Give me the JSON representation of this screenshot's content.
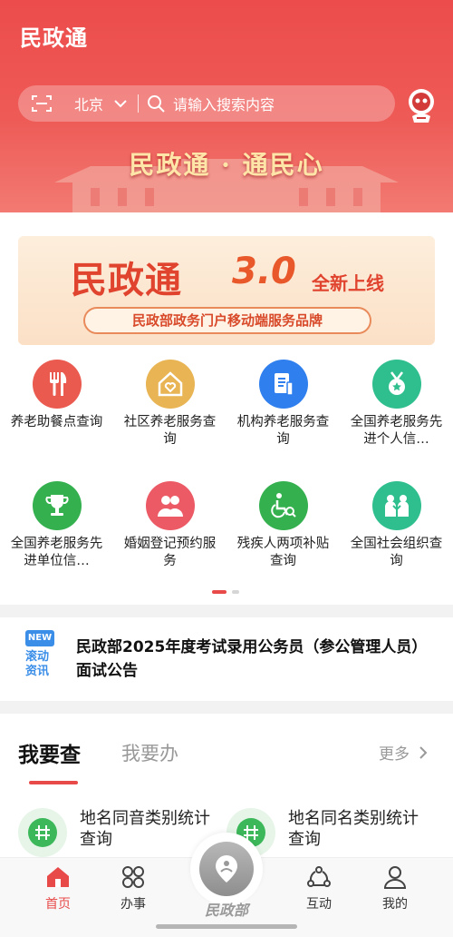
{
  "header": {
    "title": "民政通",
    "city": "北京",
    "search_placeholder": "请输入搜索内容",
    "slogan": "民政通 · 通民心"
  },
  "banner": {
    "main": "民政通",
    "version": "3.0",
    "new_text": "全新上线",
    "subtitle": "民政部政务门户移动端服务品牌"
  },
  "services": [
    {
      "label": "养老助餐点查询",
      "icon": "fork-knife-icon",
      "color": "#ea5a4f"
    },
    {
      "label": "社区养老服务查询",
      "icon": "heart-house-icon",
      "color": "#e8b454"
    },
    {
      "label": "机构养老服务查询",
      "icon": "document-icon",
      "color": "#2f7fee"
    },
    {
      "label": "全国养老服务先进个人信…",
      "icon": "medal-icon",
      "color": "#2fbf8f"
    },
    {
      "label": "全国养老服务先进单位信…",
      "icon": "trophy-icon",
      "color": "#34b04f"
    },
    {
      "label": "婚姻登记预约服务",
      "icon": "couple-icon",
      "color": "#ec5a66"
    },
    {
      "label": "残疾人两项补贴查询",
      "icon": "wheelchair-icon",
      "color": "#34b04f"
    },
    {
      "label": "全国社会组织查询",
      "icon": "people-icon",
      "color": "#2fbf8f"
    }
  ],
  "news": {
    "badge_new": "NEW",
    "badge_text": "滚动资讯",
    "text": "民政部2025年度考试录用公务员（参公管理人员）面试公告"
  },
  "query_section": {
    "tab_active": "我要查",
    "tab_inactive": "我要办",
    "more": "更多",
    "items": [
      {
        "label": "地名同音类别统计查询",
        "icon": "hash-icon"
      },
      {
        "label": "地名同名类别统计查询",
        "icon": "hash-icon"
      }
    ]
  },
  "nav": {
    "home": "首页",
    "affairs": "办事",
    "center": "民政部",
    "interact": "互动",
    "mine": "我的"
  },
  "colors": {
    "accent": "#e84a4a",
    "header": "#ec4c4c"
  }
}
